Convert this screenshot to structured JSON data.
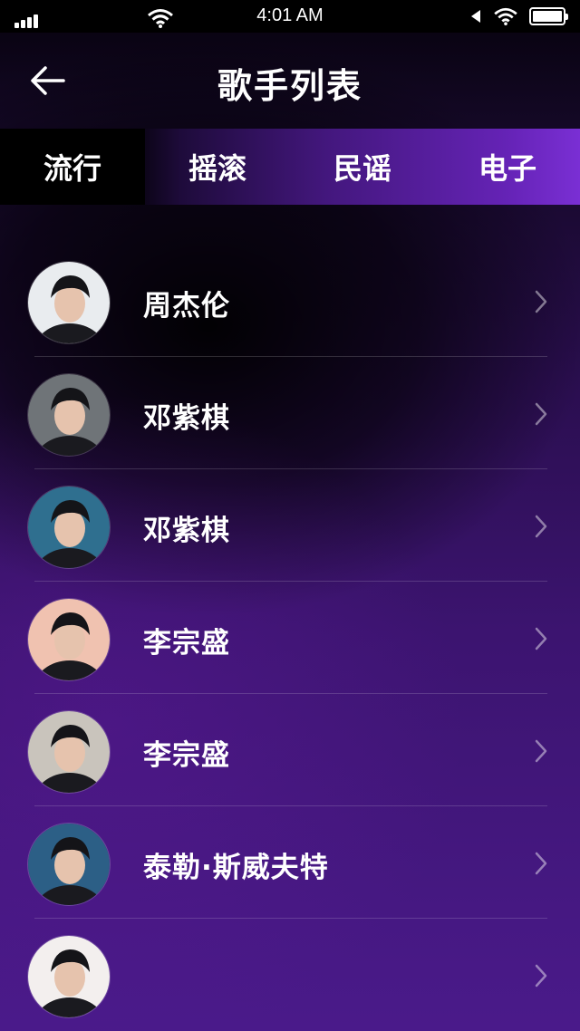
{
  "status": {
    "time": "4:01 AM"
  },
  "header": {
    "title": "歌手列表"
  },
  "tabs": [
    {
      "label": "流行",
      "active": true
    },
    {
      "label": "摇滚",
      "active": false
    },
    {
      "label": "民谣",
      "active": false
    },
    {
      "label": "电子",
      "active": false
    }
  ],
  "singers": [
    {
      "name": "周杰伦",
      "avatar_bg": "#e9ecef"
    },
    {
      "name": "邓紫棋",
      "avatar_bg": "#6f7478"
    },
    {
      "name": "邓紫棋",
      "avatar_bg": "#2f6f8f"
    },
    {
      "name": "李宗盛",
      "avatar_bg": "#f0c2b0"
    },
    {
      "name": "李宗盛",
      "avatar_bg": "#c9c4bc"
    },
    {
      "name": "泰勒·斯威夫特",
      "avatar_bg": "#2c5f86"
    },
    {
      "name": "",
      "avatar_bg": "#f3efee"
    }
  ],
  "colors": {
    "accent": "#7a2fd4",
    "background_dark": "#000000",
    "background_purple": "#4a1a8a"
  }
}
